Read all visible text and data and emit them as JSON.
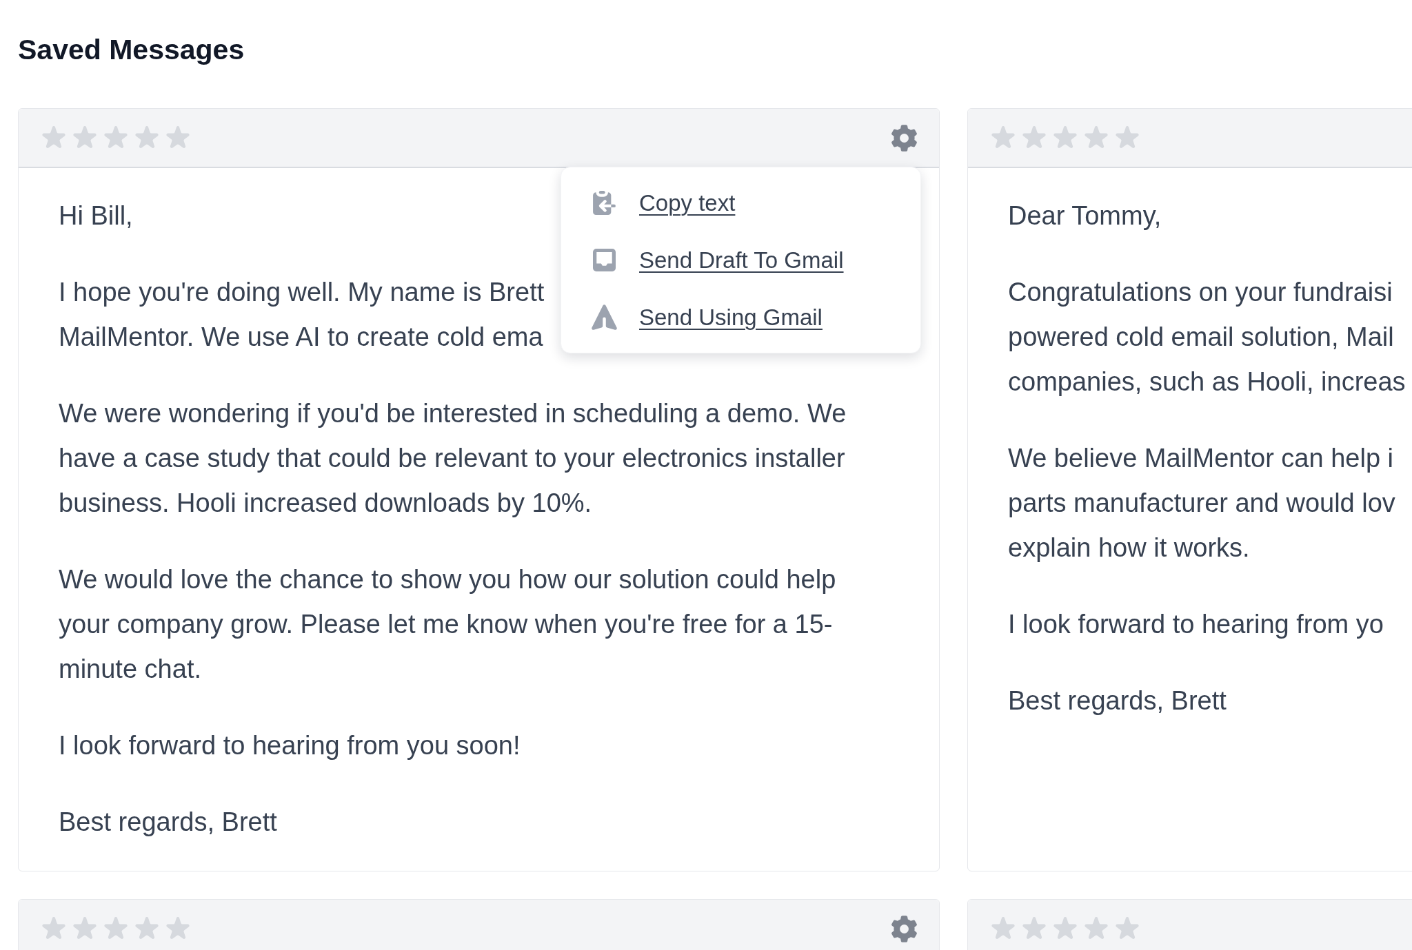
{
  "page": {
    "title": "Saved Messages"
  },
  "cards": [
    {
      "stars": 0,
      "paragraphs": [
        {
          "lines": [
            "Hi Bill,"
          ]
        },
        {
          "lines": [
            "I hope you're doing well. My name is Brett",
            "MailMentor. We use AI to create cold ema"
          ]
        },
        {
          "lines": [
            "We were wondering if you'd be interested in scheduling a demo. We",
            "have a case study that could be relevant to your electronics installer",
            "business. Hooli increased downloads by 10%."
          ]
        },
        {
          "lines": [
            "We would love the chance to show you how our solution could help",
            "your company grow. Please let me know when you're free for a 15-",
            "minute chat."
          ]
        },
        {
          "lines": [
            "I look forward to hearing from you soon!"
          ]
        },
        {
          "lines": [
            "Best regards, Brett"
          ]
        }
      ],
      "menu": {
        "items": [
          {
            "kind": "copy",
            "label": "Copy text"
          },
          {
            "kind": "draft",
            "label": "Send Draft To Gmail"
          },
          {
            "kind": "send",
            "label": "Send Using Gmail"
          }
        ]
      }
    },
    {
      "stars": 0,
      "paragraphs": [
        {
          "lines": [
            "Dear Tommy,"
          ]
        },
        {
          "lines": [
            "Congratulations on your fundraisi",
            "powered cold email solution, Mail",
            "companies, such as Hooli, increas"
          ]
        },
        {
          "lines": [
            "We believe MailMentor can help i",
            "parts manufacturer and would lov",
            "explain how it works."
          ]
        },
        {
          "lines": [
            "I look forward to hearing from yo"
          ]
        },
        {
          "lines": [
            "Best regards, Brett"
          ]
        }
      ]
    },
    {
      "stars": 0
    },
    {
      "stars": 0
    }
  ]
}
